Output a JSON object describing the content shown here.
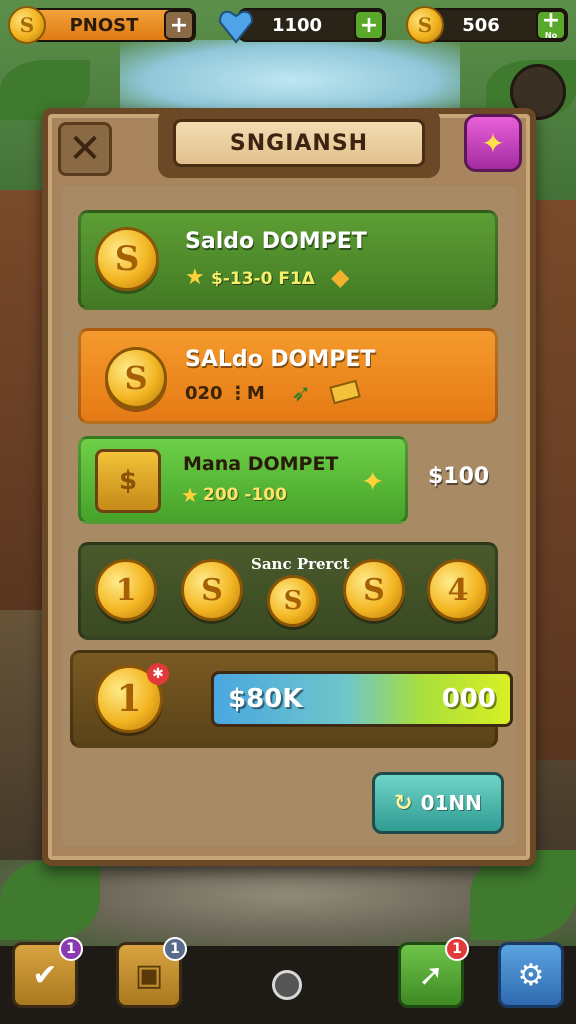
{
  "topbar": {
    "left_label": "PNOST",
    "gems_value": "1100",
    "coins_value": "506",
    "coins_sub": "No"
  },
  "panel": {
    "title": "SNGIANSH"
  },
  "rows": [
    {
      "title": "Saldo DOMPET",
      "subtitle": "$-13-0 F1Δ"
    },
    {
      "title": "SALdo DOMPET",
      "subtitle": "020 ⋮M"
    },
    {
      "title": "Mana DOMPET",
      "subtitle": "200 -100",
      "side_value": "$100"
    }
  ],
  "coin_row": {
    "label": "Sanc Prerct",
    "coins": [
      "1",
      "S",
      "S",
      "S",
      "4"
    ]
  },
  "progress": {
    "coin_label": "1",
    "left_text": "$80K",
    "right_text": "000"
  },
  "claim_button": {
    "label": "01NN"
  },
  "bottom_nav": {
    "badge1": "1",
    "badge2": "1",
    "badge3": "1"
  },
  "colors": {
    "green_row": "#4f8d2e",
    "orange_row": "#ef8a1e",
    "bright_green_row": "#5ab83a",
    "accent_gold": "#f3b623"
  }
}
